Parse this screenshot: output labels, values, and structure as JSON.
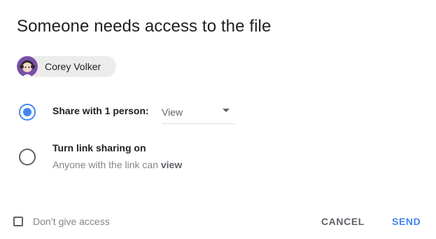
{
  "dialog": {
    "title": "Someone needs access to the file"
  },
  "requester": {
    "name": "Corey Volker"
  },
  "options": {
    "share_with_person": {
      "label": "Share with 1 person:",
      "selected": true,
      "permission": "View"
    },
    "link_sharing": {
      "label": "Turn link sharing on",
      "selected": false,
      "description_prefix": "Anyone with the link can ",
      "description_emphasis": "view"
    }
  },
  "footer": {
    "dont_give_access_label": "Don’t give access",
    "dont_give_access_checked": false,
    "cancel_label": "CANCEL",
    "send_label": "SEND"
  },
  "colors": {
    "accent": "#4285f4",
    "text_primary": "#202124",
    "text_secondary": "#80868b",
    "chip_background": "#ececec"
  }
}
